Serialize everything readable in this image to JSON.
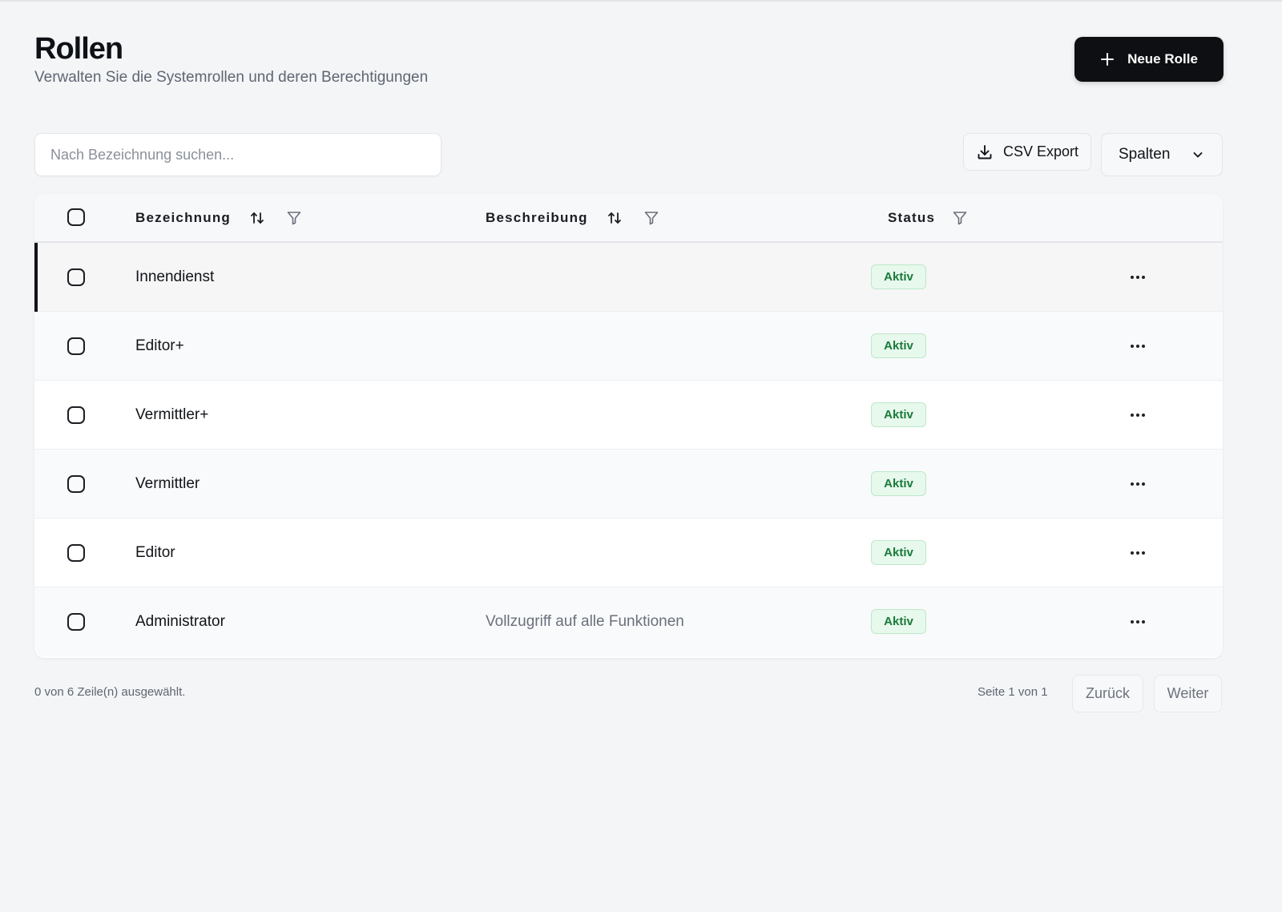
{
  "header": {
    "title": "Rollen",
    "subtitle": "Verwalten Sie die Systemrollen und deren Berechtigungen",
    "new_button_label": "Neue Rolle",
    "new_button_icon": "plus-icon"
  },
  "toolbar": {
    "search_placeholder": "Nach Bezeichnung suchen...",
    "search_value": "",
    "csv_label": "CSV Export",
    "csv_icon": "download-icon",
    "columns_label": "Spalten",
    "columns_icon": "chevron-down-icon"
  },
  "table": {
    "columns": [
      {
        "label": "Bezeichnung",
        "sortable": true,
        "filterable": true
      },
      {
        "label": "Beschreibung",
        "sortable": true,
        "filterable": true
      },
      {
        "label": "Status",
        "sortable": false,
        "filterable": true
      }
    ],
    "rows": [
      {
        "name": "Innendienst",
        "description": "",
        "status": "Aktiv",
        "selected": false,
        "highlighted": true
      },
      {
        "name": "Editor+",
        "description": "",
        "status": "Aktiv",
        "selected": false,
        "highlighted": false
      },
      {
        "name": "Vermittler+",
        "description": "",
        "status": "Aktiv",
        "selected": false,
        "highlighted": false
      },
      {
        "name": "Vermittler",
        "description": "",
        "status": "Aktiv",
        "selected": false,
        "highlighted": false
      },
      {
        "name": "Editor",
        "description": "",
        "status": "Aktiv",
        "selected": false,
        "highlighted": false
      },
      {
        "name": "Administrator",
        "description": "Vollzugriff auf alle Funktionen",
        "status": "Aktiv",
        "selected": false,
        "highlighted": false
      }
    ]
  },
  "footer": {
    "selection_text": "0 von 6 Zeile(n) ausgewählt.",
    "page_text": "Seite 1 von 1",
    "prev_label": "Zurück",
    "next_label": "Weiter"
  },
  "colors": {
    "primary_button": "#0d0f12",
    "status_active_bg": "#e7f8ec",
    "status_active_text": "#1a7a3b",
    "page_background": "#f4f5f7"
  }
}
